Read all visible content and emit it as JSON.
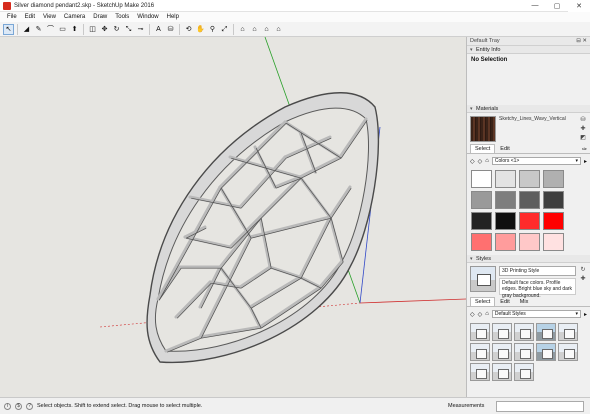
{
  "window": {
    "title": "Silver diamond pendant2.skp - SketchUp Make 2016",
    "minimize_icon": "minimize-icon",
    "maximize_icon": "maximize-icon",
    "close_icon": "close-icon"
  },
  "menu": [
    "File",
    "Edit",
    "View",
    "Camera",
    "Draw",
    "Tools",
    "Window",
    "Help"
  ],
  "toolbar": {
    "tools": [
      {
        "name": "select-tool-icon",
        "glyph": "↖",
        "active": true
      },
      {
        "name": "eraser-tool-icon",
        "glyph": "◢"
      },
      {
        "name": "pencil-line-tool-icon",
        "glyph": "✎"
      },
      {
        "name": "arc-tool-icon",
        "glyph": "⌒"
      },
      {
        "name": "rectangle-tool-icon",
        "glyph": "▭"
      },
      {
        "name": "push-pull-tool-icon",
        "glyph": "⬆"
      },
      {
        "name": "offset-tool-icon",
        "glyph": "◫"
      },
      {
        "name": "move-tool-icon",
        "glyph": "✥"
      },
      {
        "name": "rotate-tool-icon",
        "glyph": "↻"
      },
      {
        "name": "scale-tool-icon",
        "glyph": "⤡"
      },
      {
        "name": "tape-measure-tool-icon",
        "glyph": "⊸"
      },
      {
        "name": "text-tool-icon",
        "glyph": "A"
      },
      {
        "name": "paint-bucket-tool-icon",
        "glyph": "⛁"
      },
      {
        "name": "orbit-tool-icon",
        "glyph": "⟲"
      },
      {
        "name": "pan-tool-icon",
        "glyph": "✋"
      },
      {
        "name": "zoom-tool-icon",
        "glyph": "⚲"
      },
      {
        "name": "zoom-extents-tool-icon",
        "glyph": "⤢"
      },
      {
        "name": "warehouse-icon",
        "glyph": "⌂"
      },
      {
        "name": "extension-warehouse-icon",
        "glyph": "⌂"
      },
      {
        "name": "share-model-icon",
        "glyph": "⌂"
      },
      {
        "name": "layout-icon",
        "glyph": "⌂"
      }
    ]
  },
  "tray": {
    "title": "Default Tray",
    "entity_info": {
      "header": "Entity Info",
      "value": "No Selection"
    },
    "materials": {
      "header": "Materials",
      "name": "Sketchy_Lines_Wavy_Vertical",
      "tab_select": "Select",
      "tab_edit": "Edit",
      "collection": "Colors <1>",
      "colors": [
        "#ffffff",
        "#e3e3e3",
        "#c8c8c8",
        "#b0b0b0",
        "#9a9a9a",
        "#7e7e7e",
        "#5e5e5e",
        "#3e3e3e",
        "#232323",
        "#0f0f0f",
        "#ff2b2b",
        "#ff0000",
        "#ff7070",
        "#ff9c9c",
        "#ffc8c8",
        "#ffe1e1"
      ]
    },
    "styles": {
      "header": "Styles",
      "name": "3D Printing Style",
      "description": "Default face colors. Profile edges. Bright blue sky and dark gray background.",
      "tab_select": "Select",
      "tab_edit": "Edit",
      "tab_mix": "Mix",
      "collection": "Default Styles",
      "thumb_count": 13
    }
  },
  "status": {
    "text": "Select objects. Shift to extend select. Drag mouse to select multiple.",
    "measurements_label": "Measurements"
  }
}
